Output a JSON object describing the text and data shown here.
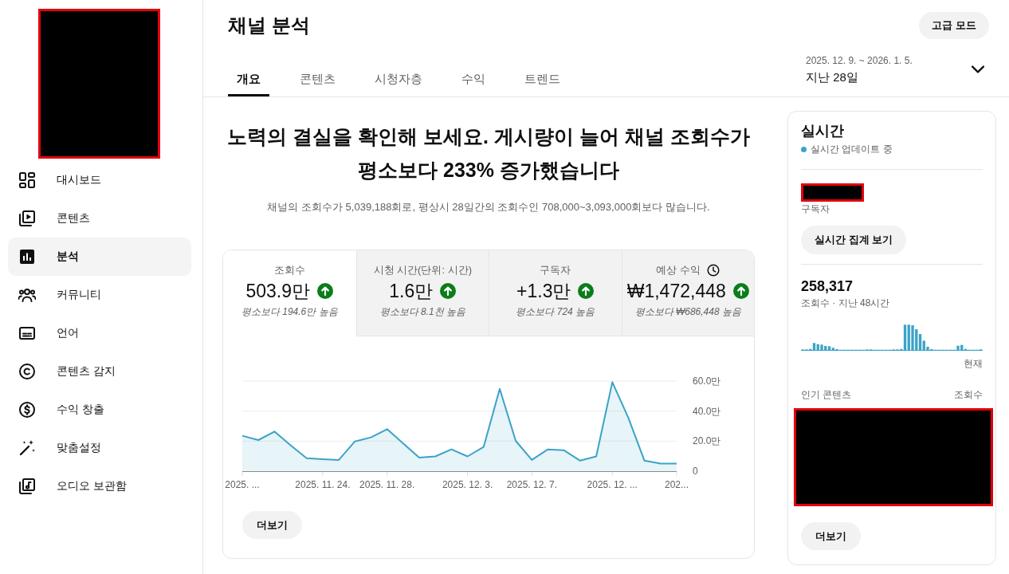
{
  "sidebar": {
    "items": [
      {
        "label": "대시보드",
        "selected": false
      },
      {
        "label": "콘텐츠",
        "selected": false
      },
      {
        "label": "분석",
        "selected": true
      },
      {
        "label": "커뮤니티",
        "selected": false
      },
      {
        "label": "언어",
        "selected": false
      },
      {
        "label": "콘텐츠 감지",
        "selected": false
      },
      {
        "label": "수익 창출",
        "selected": false
      },
      {
        "label": "맞춤설정",
        "selected": false
      },
      {
        "label": "오디오 보관함",
        "selected": false
      }
    ]
  },
  "header": {
    "title": "채널 분석",
    "advanced_button": "고급 모드",
    "tabs": [
      {
        "label": "개요",
        "selected": true
      },
      {
        "label": "콘텐츠",
        "selected": false
      },
      {
        "label": "시청자층",
        "selected": false
      },
      {
        "label": "수익",
        "selected": false
      },
      {
        "label": "트렌드",
        "selected": false
      }
    ],
    "date_range": {
      "range": "2025. 12. 9. ~ 2026. 1. 5.",
      "period": "지난 28일"
    }
  },
  "overview": {
    "headline": "노력의 결실을 확인해 보세요. 게시량이 늘어 채널 조회수가 평소보다 233% 증가했습니다",
    "description": "채널의 조회수가 5,039,188회로, 평상시 28일간의 조회수인 708,000~3,093,000회보다 많습니다.",
    "metrics": [
      {
        "label": "조회수",
        "info": false,
        "value": "503.9만",
        "increase": true,
        "comparison": "평소보다 194.6만 높음",
        "selected": true
      },
      {
        "label": "시청 시간(단위: 시간)",
        "info": false,
        "value": "1.6만",
        "increase": true,
        "comparison": "평소보다 8.1천 높음",
        "selected": false
      },
      {
        "label": "구독자",
        "info": false,
        "value": "+1.3만",
        "increase": true,
        "comparison": "평소보다 724 높음",
        "selected": false
      },
      {
        "label": "예상 수익",
        "info": true,
        "value": "₩1,472,448",
        "increase": true,
        "comparison": "평소보다 ₩686,448 높음",
        "selected": false
      }
    ],
    "chart_data": [
      {
        "type": "area",
        "categories": [
          "2025. ...",
          null,
          null,
          null,
          null,
          "2025. 11. 24.",
          null,
          null,
          null,
          "2025. 11. 28.",
          null,
          null,
          null,
          null,
          "2025. 12. 3.",
          null,
          null,
          null,
          "2025. 12. 7.",
          null,
          null,
          null,
          null,
          "2025. 12. ...",
          null,
          null,
          null,
          "202..."
        ],
        "values": [
          23.6,
          20.7,
          26.4,
          17.3,
          8.6,
          8.0,
          7.5,
          19.8,
          22.5,
          28.0,
          18.4,
          9.1,
          9.8,
          14.5,
          9.8,
          16.1,
          54.8,
          20.2,
          7.5,
          14.5,
          13.9,
          7.0,
          9.8,
          59.3,
          35.5,
          7.0,
          5.0,
          5.0
        ],
        "color": "#3ba3c7",
        "ylim": [
          0,
          60
        ],
        "yticks": [
          {
            "value": 0,
            "label": "0"
          },
          {
            "value": 20,
            "label": "20.0만"
          },
          {
            "value": 40,
            "label": "40.0만"
          },
          {
            "value": 60,
            "label": "60.0만"
          }
        ],
        "grid": true
      }
    ],
    "more_button": "더보기"
  },
  "realtime": {
    "title": "실시간",
    "status": "실시간 업데이트 중",
    "subscribers_label": "구독자",
    "live_button": "실시간 집계 보기",
    "views": "258,317",
    "views_caption": "조회수 · 지난 48시간",
    "sparkline_end_label": "현재",
    "top_content_label": "인기 콘텐츠",
    "top_content_metric": "조회수",
    "more_button": "더보기"
  }
}
